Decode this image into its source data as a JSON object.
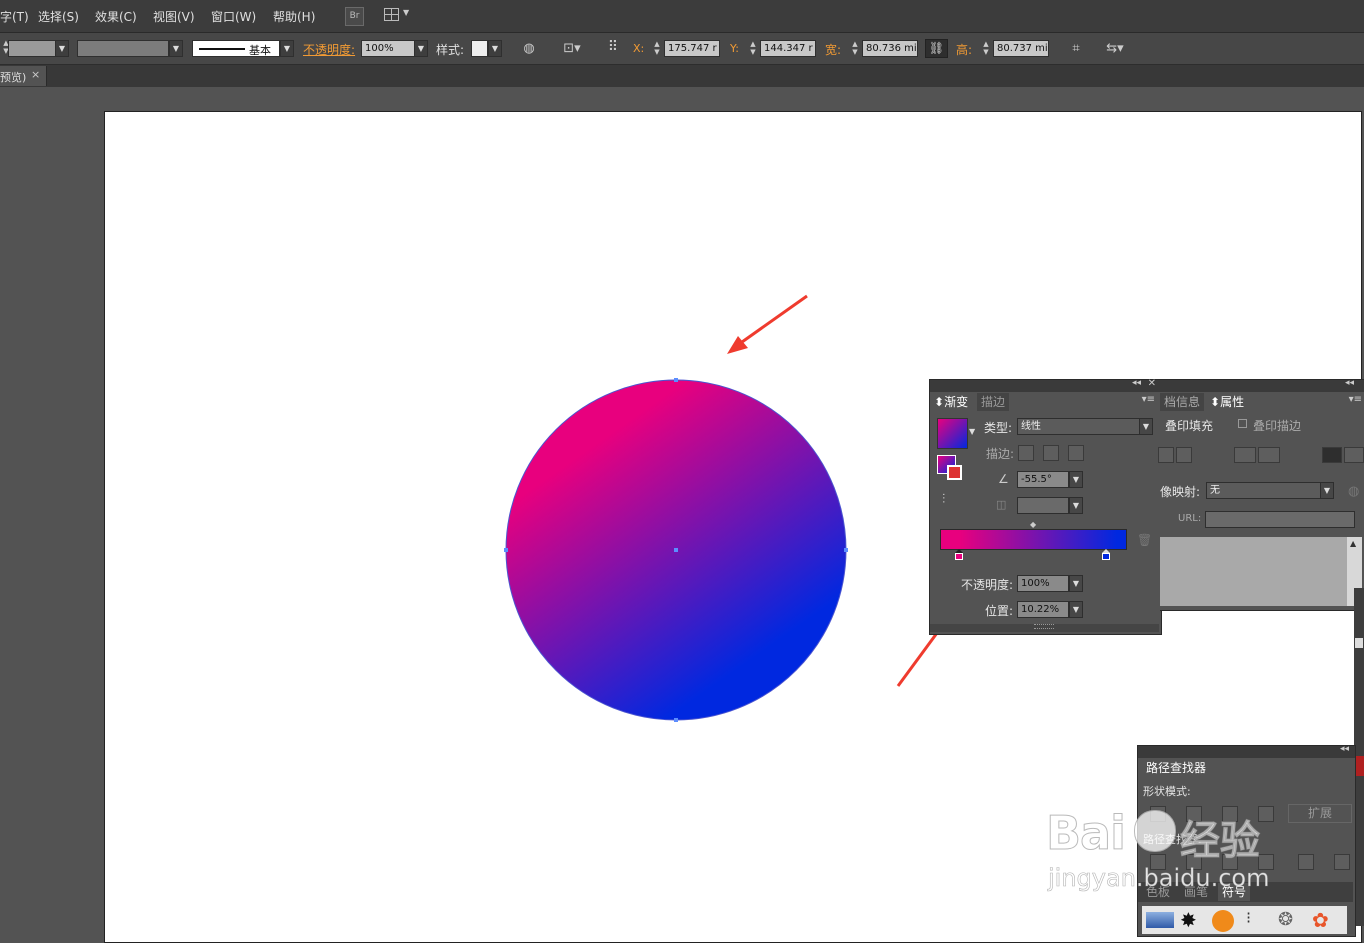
{
  "menubar": {
    "items": [
      "字(T)",
      "选择(S)",
      "效果(C)",
      "视图(V)",
      "窗口(W)",
      "帮助(H)"
    ],
    "bridge_button": "Br"
  },
  "controlbar": {
    "stroke_style": "基本",
    "opacity_label": "不透明度:",
    "opacity_value": "100%",
    "style_label": "样式:",
    "x_label": "X:",
    "x_value": "175.747 r",
    "y_label": "Y:",
    "y_value": "144.347 r",
    "w_label": "宽:",
    "w_value": "80.736 mi",
    "h_label": "高:",
    "h_value": "80.737 mi"
  },
  "document_tab": {
    "label": "预览)",
    "close": "×"
  },
  "gradient_panel": {
    "tab_gradient": "渐变",
    "tab_stroke": "描边",
    "type_label": "类型:",
    "type_value": "线性",
    "stroke_label": "描边:",
    "angle_value": "-55.5°",
    "opacity_label": "不透明度:",
    "opacity_value": "100%",
    "position_label": "位置:",
    "position_value": "10.22%",
    "start_color": "#e8007e",
    "end_color": "#0028e0"
  },
  "attributes_panel": {
    "tab_docinfo": "档信息",
    "tab_attributes": "属性",
    "overprint_fill": "叠印填充",
    "overprint_stroke": "叠印描边",
    "imagemap_label": "像映射:",
    "imagemap_value": "无",
    "url_label": "URL:"
  },
  "pathfinder_panel": {
    "title": "路径查找器",
    "shape_modes_label": "形状模式:",
    "expand_button": "扩展",
    "pathfinders_label": "路径查找器:",
    "bottom_tabs": [
      "色板",
      "画笔",
      "符号"
    ]
  },
  "watermark": {
    "brand": "Bai",
    "brand2": "经验",
    "url": "jingyan.baidu.com"
  },
  "colors": {
    "arrow": "#ef3b2e",
    "gradient_start": "#e8007e",
    "gradient_end": "#0028e0",
    "accent_label": "#f29b34"
  }
}
